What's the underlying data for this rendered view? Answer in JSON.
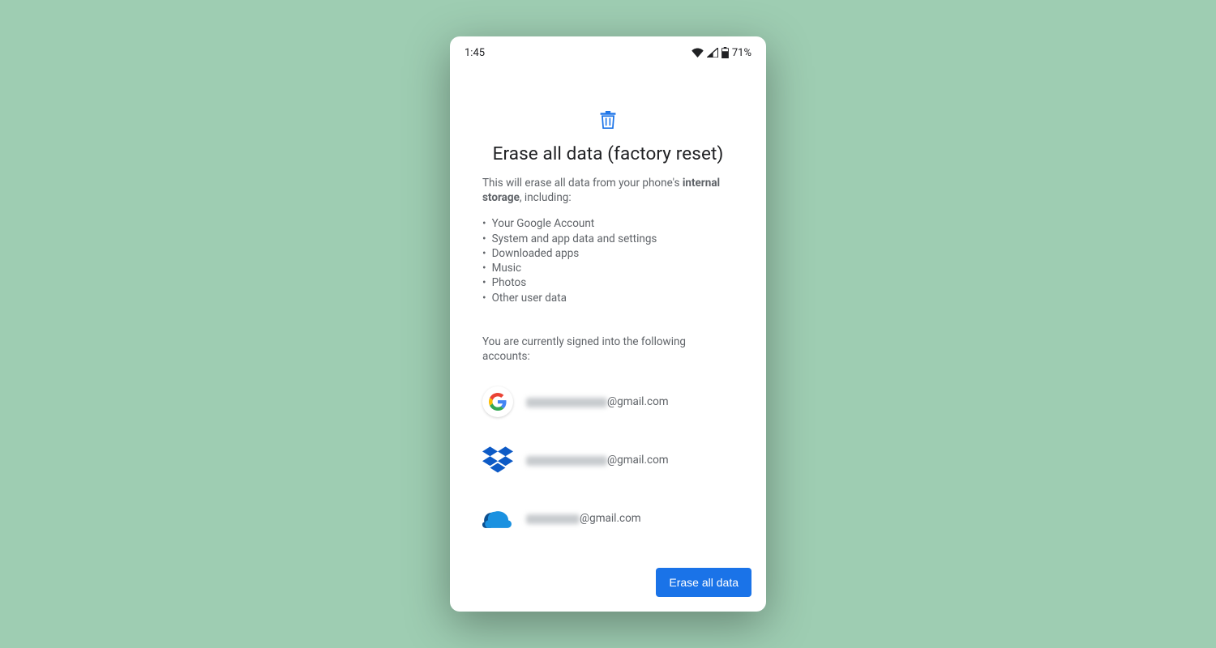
{
  "status": {
    "time": "1:45",
    "battery": "71%"
  },
  "header": {
    "title": "Erase all data (factory reset)"
  },
  "description": {
    "prefix": "This will erase all data from your phone's ",
    "bold": "internal storage",
    "suffix": ", including:"
  },
  "bullets": [
    "Your Google Account",
    "System and app data and settings",
    "Downloaded apps",
    "Music",
    "Photos",
    "Other user data"
  ],
  "accounts_label": "You are currently signed into the following accounts:",
  "accounts": [
    {
      "provider": "google",
      "suffix": "@gmail.com",
      "redacted_width": 100
    },
    {
      "provider": "dropbox",
      "suffix": "@gmail.com",
      "redacted_width": 100
    },
    {
      "provider": "onedrive",
      "suffix": "@gmail.com",
      "redacted_width": 66
    }
  ],
  "footer": {
    "erase_button": "Erase all data"
  },
  "colors": {
    "accent": "#1a73e8"
  }
}
